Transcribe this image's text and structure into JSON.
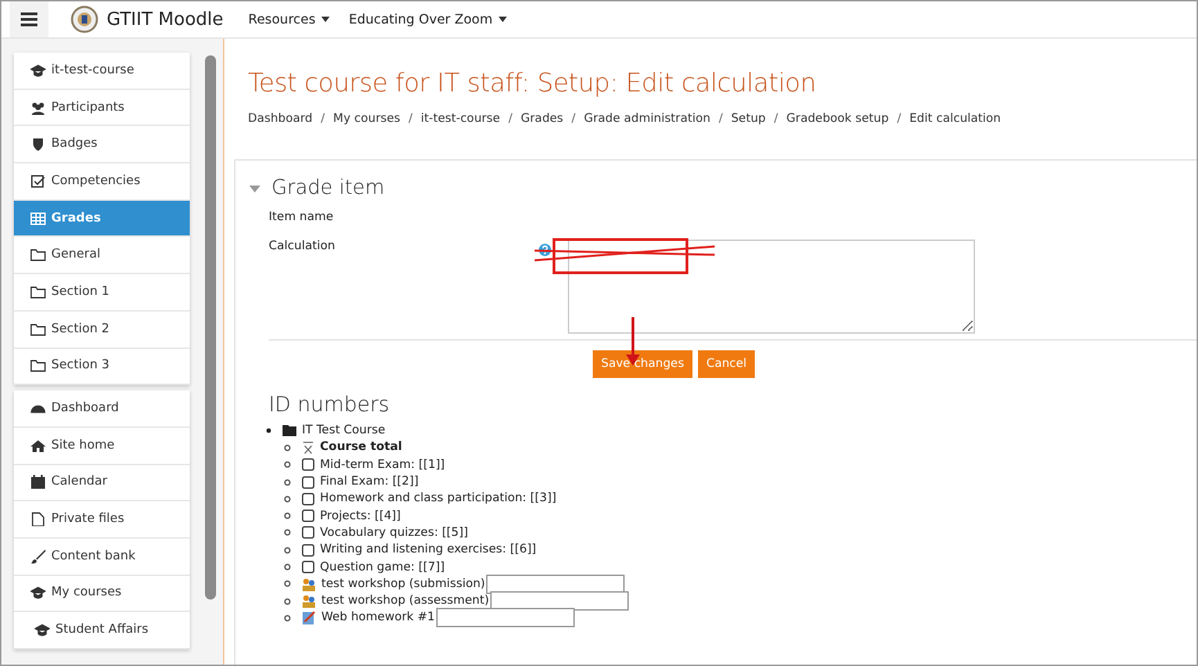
{
  "navbar": {
    "site_name": "GTIIT Moodle",
    "menus": [
      {
        "label": "Resources"
      },
      {
        "label": "Educating Over Zoom"
      }
    ]
  },
  "sidebar": {
    "groups": [
      [
        {
          "label": "it-test-course",
          "kind": "cap",
          "selected": false
        },
        {
          "label": "Participants",
          "kind": "users",
          "selected": false
        },
        {
          "label": "Badges",
          "kind": "shield",
          "selected": false
        },
        {
          "label": "Competencies",
          "kind": "check",
          "selected": false
        },
        {
          "label": "Grades",
          "kind": "table",
          "selected": true
        },
        {
          "label": "General",
          "kind": "folder",
          "selected": false
        },
        {
          "label": "Section 1",
          "kind": "folder",
          "selected": false
        },
        {
          "label": "Section 2",
          "kind": "folder",
          "selected": false
        },
        {
          "label": "Section 3",
          "kind": "folder",
          "selected": false
        }
      ],
      [
        {
          "label": "Dashboard",
          "kind": "gauge",
          "selected": false
        },
        {
          "label": "Site home",
          "kind": "home",
          "selected": false
        },
        {
          "label": "Calendar",
          "kind": "calendar",
          "selected": false
        },
        {
          "label": "Private files",
          "kind": "file",
          "selected": false
        },
        {
          "label": "Content bank",
          "kind": "brush",
          "selected": false
        },
        {
          "label": "My courses",
          "kind": "cap",
          "selected": false
        },
        {
          "label": "Student Affairs",
          "kind": "cap",
          "selected": false
        }
      ]
    ]
  },
  "page": {
    "title": "Test course for IT staff: Setup: Edit calculation",
    "breadcrumb_separator": "/",
    "breadcrumb": [
      "Dashboard",
      "My courses",
      "it-test-course",
      "Grades",
      "Grade administration",
      "Setup",
      "Gradebook setup",
      "Edit calculation"
    ]
  },
  "form": {
    "section": "Grade item",
    "expanded": true,
    "item_name_label": "Item name",
    "calculation_label": "Calculation",
    "buttons": [
      {
        "label": "Save changes"
      },
      {
        "label": "Cancel"
      }
    ]
  },
  "id_numbers": {
    "heading": "ID numbers",
    "tree": [
      {
        "label": "IT Test Course",
        "kind": "category",
        "children": [
          {
            "label": "Course total",
            "kind": "total"
          },
          {
            "label": "Mid-term Exam: [[1]]",
            "kind": "item"
          },
          {
            "label": "Final Exam: [[2]]",
            "kind": "item"
          },
          {
            "label": "Homework and class participation: [[3]]",
            "kind": "item"
          },
          {
            "label": "Projects: [[4]]",
            "kind": "item"
          },
          {
            "label": "Vocabulary quizzes: [[5]]",
            "kind": "item"
          },
          {
            "label": "Writing and listening exercises: [[6]]",
            "kind": "item"
          },
          {
            "label": "Question game: [[7]]",
            "kind": "item"
          },
          {
            "label": "test workshop (submission)",
            "kind": "workshop"
          },
          {
            "label": "test workshop (assessment)",
            "kind": "workshop"
          },
          {
            "label": "Web homework #1",
            "kind": "homework"
          }
        ]
      }
    ]
  }
}
